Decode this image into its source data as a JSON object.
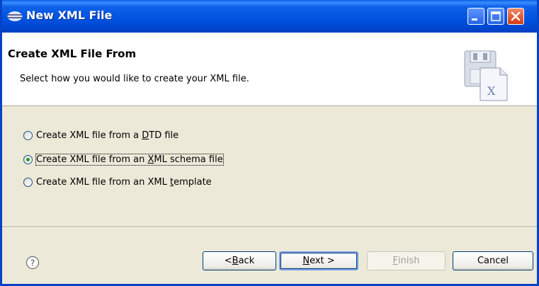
{
  "window": {
    "title": "New XML File"
  },
  "banner": {
    "title": "Create XML File From",
    "description": "Select how you would like to create your XML file."
  },
  "options": [
    {
      "pre": "Create XML file from a ",
      "mnemonic": "D",
      "post": "TD file",
      "selected": false
    },
    {
      "pre": "Create XML file from an ",
      "mnemonic": "X",
      "post": "ML schema file",
      "selected": true
    },
    {
      "pre": "Create XML file from an XML ",
      "mnemonic": "t",
      "post": "emplate",
      "selected": false
    }
  ],
  "buttons": {
    "back": {
      "pre": "< ",
      "mnemonic": "B",
      "post": "ack"
    },
    "next": {
      "pre": "",
      "mnemonic": "N",
      "post": "ext >"
    },
    "finish": {
      "pre": "",
      "mnemonic": "F",
      "post": "inish",
      "enabled": false
    },
    "cancel": {
      "label": "Cancel"
    }
  },
  "icons": {
    "app": "eclipse-icon",
    "help": "help-icon",
    "banner": "xml-file-wizard-icon"
  },
  "colors": {
    "titlebar": "#0051e0",
    "radio_selected": "#21a121",
    "window_bg": "#ece9d8"
  }
}
